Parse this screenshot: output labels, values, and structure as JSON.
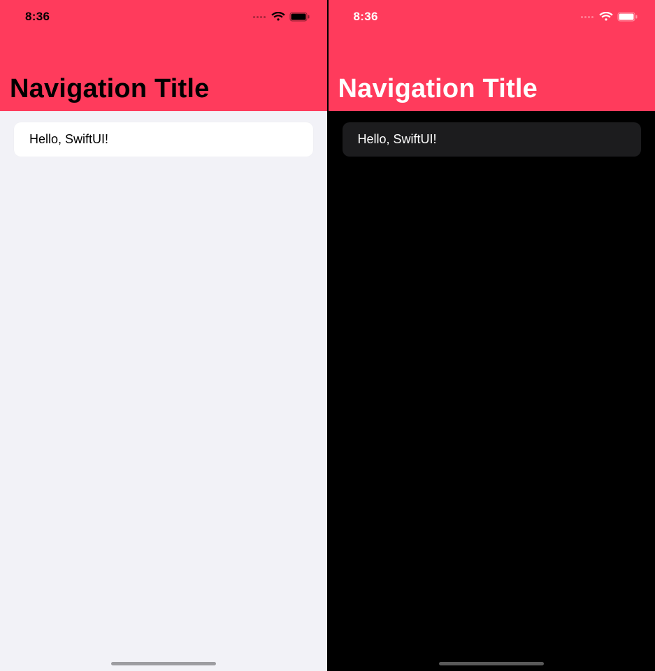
{
  "accent_color": "#ff3b5c",
  "light": {
    "status_time": "8:36",
    "nav_title": "Navigation Title",
    "cell_text": "Hello, SwiftUI!",
    "background": "#f2f2f7",
    "foreground": "#000000",
    "cell_bg": "#ffffff"
  },
  "dark": {
    "status_time": "8:36",
    "nav_title": "Navigation Title",
    "cell_text": "Hello, SwiftUI!",
    "background": "#000000",
    "foreground": "#ffffff",
    "cell_bg": "#1c1c1e"
  }
}
